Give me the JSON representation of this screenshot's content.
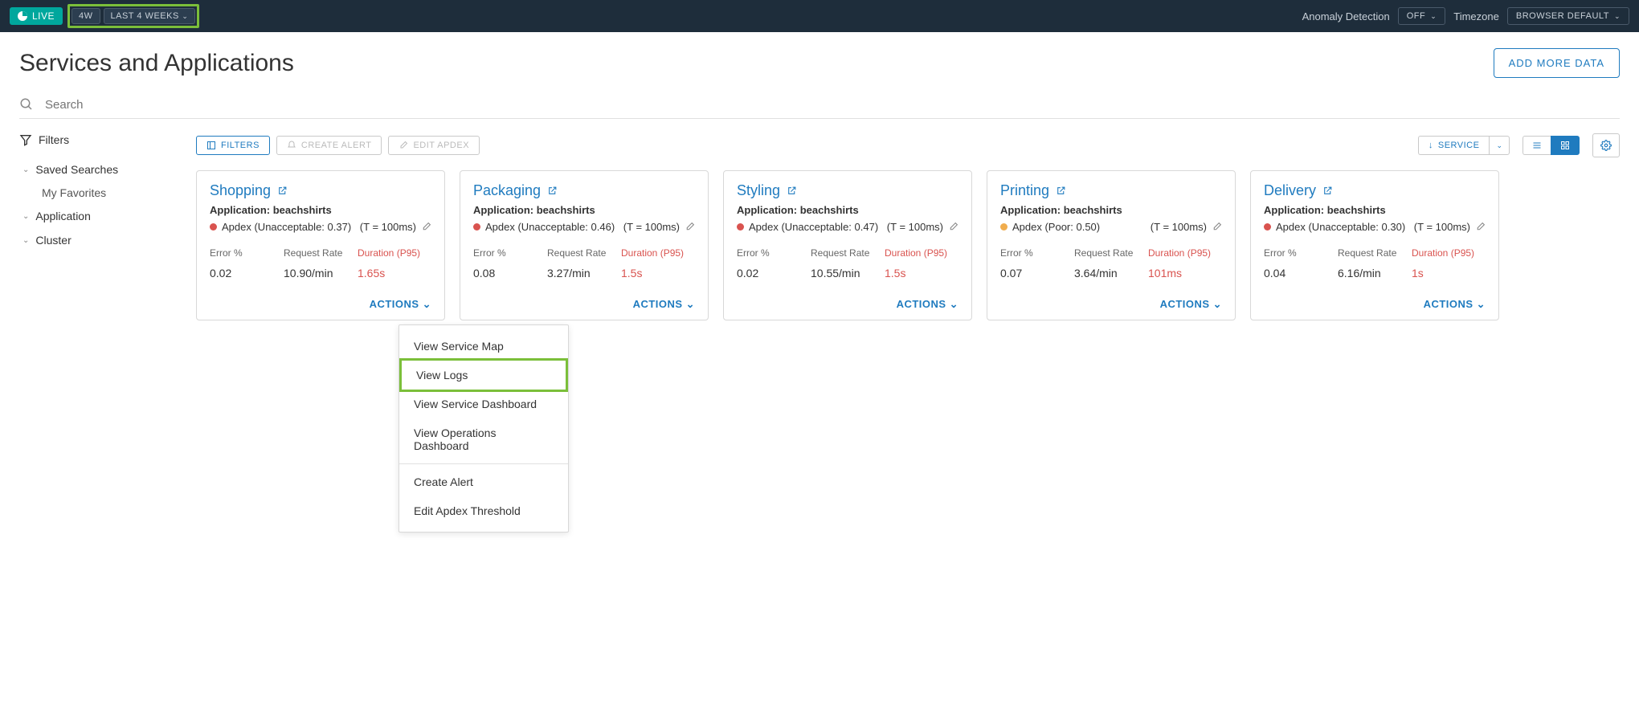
{
  "topbar": {
    "live": "LIVE",
    "range_short": "4W",
    "range_long": "LAST 4 WEEKS",
    "anomaly_label": "Anomaly Detection",
    "anomaly_value": "OFF",
    "timezone_label": "Timezone",
    "timezone_value": "BROWSER DEFAULT"
  },
  "page": {
    "title": "Services and Applications",
    "add_data": "ADD MORE DATA",
    "search_placeholder": "Search"
  },
  "sidebar": {
    "filters_label": "Filters",
    "groups": [
      {
        "label": "Saved Searches",
        "children": [
          "My Favorites"
        ]
      },
      {
        "label": "Application",
        "children": []
      },
      {
        "label": "Cluster",
        "children": []
      }
    ]
  },
  "toolbar": {
    "filters": "FILTERS",
    "create_alert": "CREATE ALERT",
    "edit_apdex": "EDIT APDEX",
    "sort": "SERVICE"
  },
  "metric_labels": {
    "error": "Error %",
    "rate": "Request Rate",
    "duration": "Duration (P95)"
  },
  "actions_label": "ACTIONS",
  "cards": [
    {
      "title": "Shopping",
      "app": "Application: beachshirts",
      "apdex": "Apdex (Unacceptable: 0.37)",
      "apdex_color": "red",
      "threshold": "(T = 100ms)",
      "error": "0.02",
      "rate": "10.90/min",
      "duration": "1.65s"
    },
    {
      "title": "Packaging",
      "app": "Application: beachshirts",
      "apdex": "Apdex (Unacceptable: 0.46)",
      "apdex_color": "red",
      "threshold": "(T = 100ms)",
      "error": "0.08",
      "rate": "3.27/min",
      "duration": "1.5s"
    },
    {
      "title": "Styling",
      "app": "Application: beachshirts",
      "apdex": "Apdex (Unacceptable: 0.47)",
      "apdex_color": "red",
      "threshold": "(T = 100ms)",
      "error": "0.02",
      "rate": "10.55/min",
      "duration": "1.5s"
    },
    {
      "title": "Printing",
      "app": "Application: beachshirts",
      "apdex": "Apdex (Poor: 0.50)",
      "apdex_color": "orange",
      "threshold": "(T = 100ms)",
      "error": "0.07",
      "rate": "3.64/min",
      "duration": "101ms"
    },
    {
      "title": "Delivery",
      "app": "Application: beachshirts",
      "apdex": "Apdex (Unacceptable: 0.30)",
      "apdex_color": "red",
      "threshold": "(T = 100ms)",
      "error": "0.04",
      "rate": "6.16/min",
      "duration": "1s"
    }
  ],
  "menu": {
    "items": [
      "View Service Map",
      "View Logs",
      "View Service Dashboard",
      "View Operations Dashboard"
    ],
    "items2": [
      "Create Alert",
      "Edit Apdex Threshold"
    ],
    "highlighted_index": 1
  }
}
